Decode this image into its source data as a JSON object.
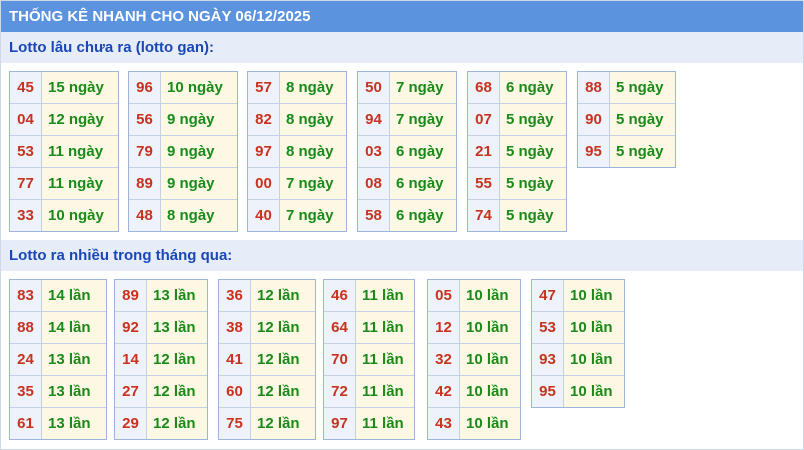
{
  "header": {
    "title": "THỐNG KÊ NHANH CHO NGÀY 06/12/2025"
  },
  "gan": {
    "title": "Lotto lâu chưa ra (lotto gan):",
    "groups": [
      [
        {
          "num": "45",
          "val": "15 ngày"
        },
        {
          "num": "04",
          "val": "12 ngày"
        },
        {
          "num": "53",
          "val": "11 ngày"
        },
        {
          "num": "77",
          "val": "11 ngày"
        },
        {
          "num": "33",
          "val": "10 ngày"
        }
      ],
      [
        {
          "num": "96",
          "val": "10 ngày"
        },
        {
          "num": "56",
          "val": "9 ngày"
        },
        {
          "num": "79",
          "val": "9 ngày"
        },
        {
          "num": "89",
          "val": "9 ngày"
        },
        {
          "num": "48",
          "val": "8 ngày"
        }
      ],
      [
        {
          "num": "57",
          "val": "8 ngày"
        },
        {
          "num": "82",
          "val": "8 ngày"
        },
        {
          "num": "97",
          "val": "8 ngày"
        },
        {
          "num": "00",
          "val": "7 ngày"
        },
        {
          "num": "40",
          "val": "7 ngày"
        }
      ],
      [
        {
          "num": "50",
          "val": "7 ngày"
        },
        {
          "num": "94",
          "val": "7 ngày"
        },
        {
          "num": "03",
          "val": "6 ngày"
        },
        {
          "num": "08",
          "val": "6 ngày"
        },
        {
          "num": "58",
          "val": "6 ngày"
        }
      ],
      [
        {
          "num": "68",
          "val": "6 ngày"
        },
        {
          "num": "07",
          "val": "5 ngày"
        },
        {
          "num": "21",
          "val": "5 ngày"
        },
        {
          "num": "55",
          "val": "5 ngày"
        },
        {
          "num": "74",
          "val": "5 ngày"
        }
      ],
      [
        {
          "num": "88",
          "val": "5 ngày"
        },
        {
          "num": "90",
          "val": "5 ngày"
        },
        {
          "num": "95",
          "val": "5 ngày"
        }
      ]
    ]
  },
  "nhieu": {
    "title": "Lotto ra nhiều trong tháng qua:",
    "groups": [
      [
        {
          "num": "83",
          "val": "14 lần"
        },
        {
          "num": "88",
          "val": "14 lần"
        },
        {
          "num": "24",
          "val": "13 lần"
        },
        {
          "num": "35",
          "val": "13 lần"
        },
        {
          "num": "61",
          "val": "13 lần"
        }
      ],
      [
        {
          "num": "89",
          "val": "13 lần"
        },
        {
          "num": "92",
          "val": "13 lần"
        },
        {
          "num": "14",
          "val": "12 lần"
        },
        {
          "num": "27",
          "val": "12 lần"
        },
        {
          "num": "29",
          "val": "12 lần"
        }
      ],
      [
        {
          "num": "36",
          "val": "12 lần"
        },
        {
          "num": "38",
          "val": "12 lần"
        },
        {
          "num": "41",
          "val": "12 lần"
        },
        {
          "num": "60",
          "val": "12 lần"
        },
        {
          "num": "75",
          "val": "12 lần"
        }
      ],
      [
        {
          "num": "46",
          "val": "11 lần"
        },
        {
          "num": "64",
          "val": "11 lần"
        },
        {
          "num": "70",
          "val": "11 lần"
        },
        {
          "num": "72",
          "val": "11 lần"
        },
        {
          "num": "97",
          "val": "11 lần"
        }
      ],
      [
        {
          "num": "05",
          "val": "10 lần"
        },
        {
          "num": "12",
          "val": "10 lần"
        },
        {
          "num": "32",
          "val": "10 lần"
        },
        {
          "num": "42",
          "val": "10 lần"
        },
        {
          "num": "43",
          "val": "10 lần"
        }
      ],
      [
        {
          "num": "47",
          "val": "10 lần"
        },
        {
          "num": "53",
          "val": "10 lần"
        },
        {
          "num": "93",
          "val": "10 lần"
        },
        {
          "num": "95",
          "val": "10 lần"
        }
      ]
    ]
  }
}
